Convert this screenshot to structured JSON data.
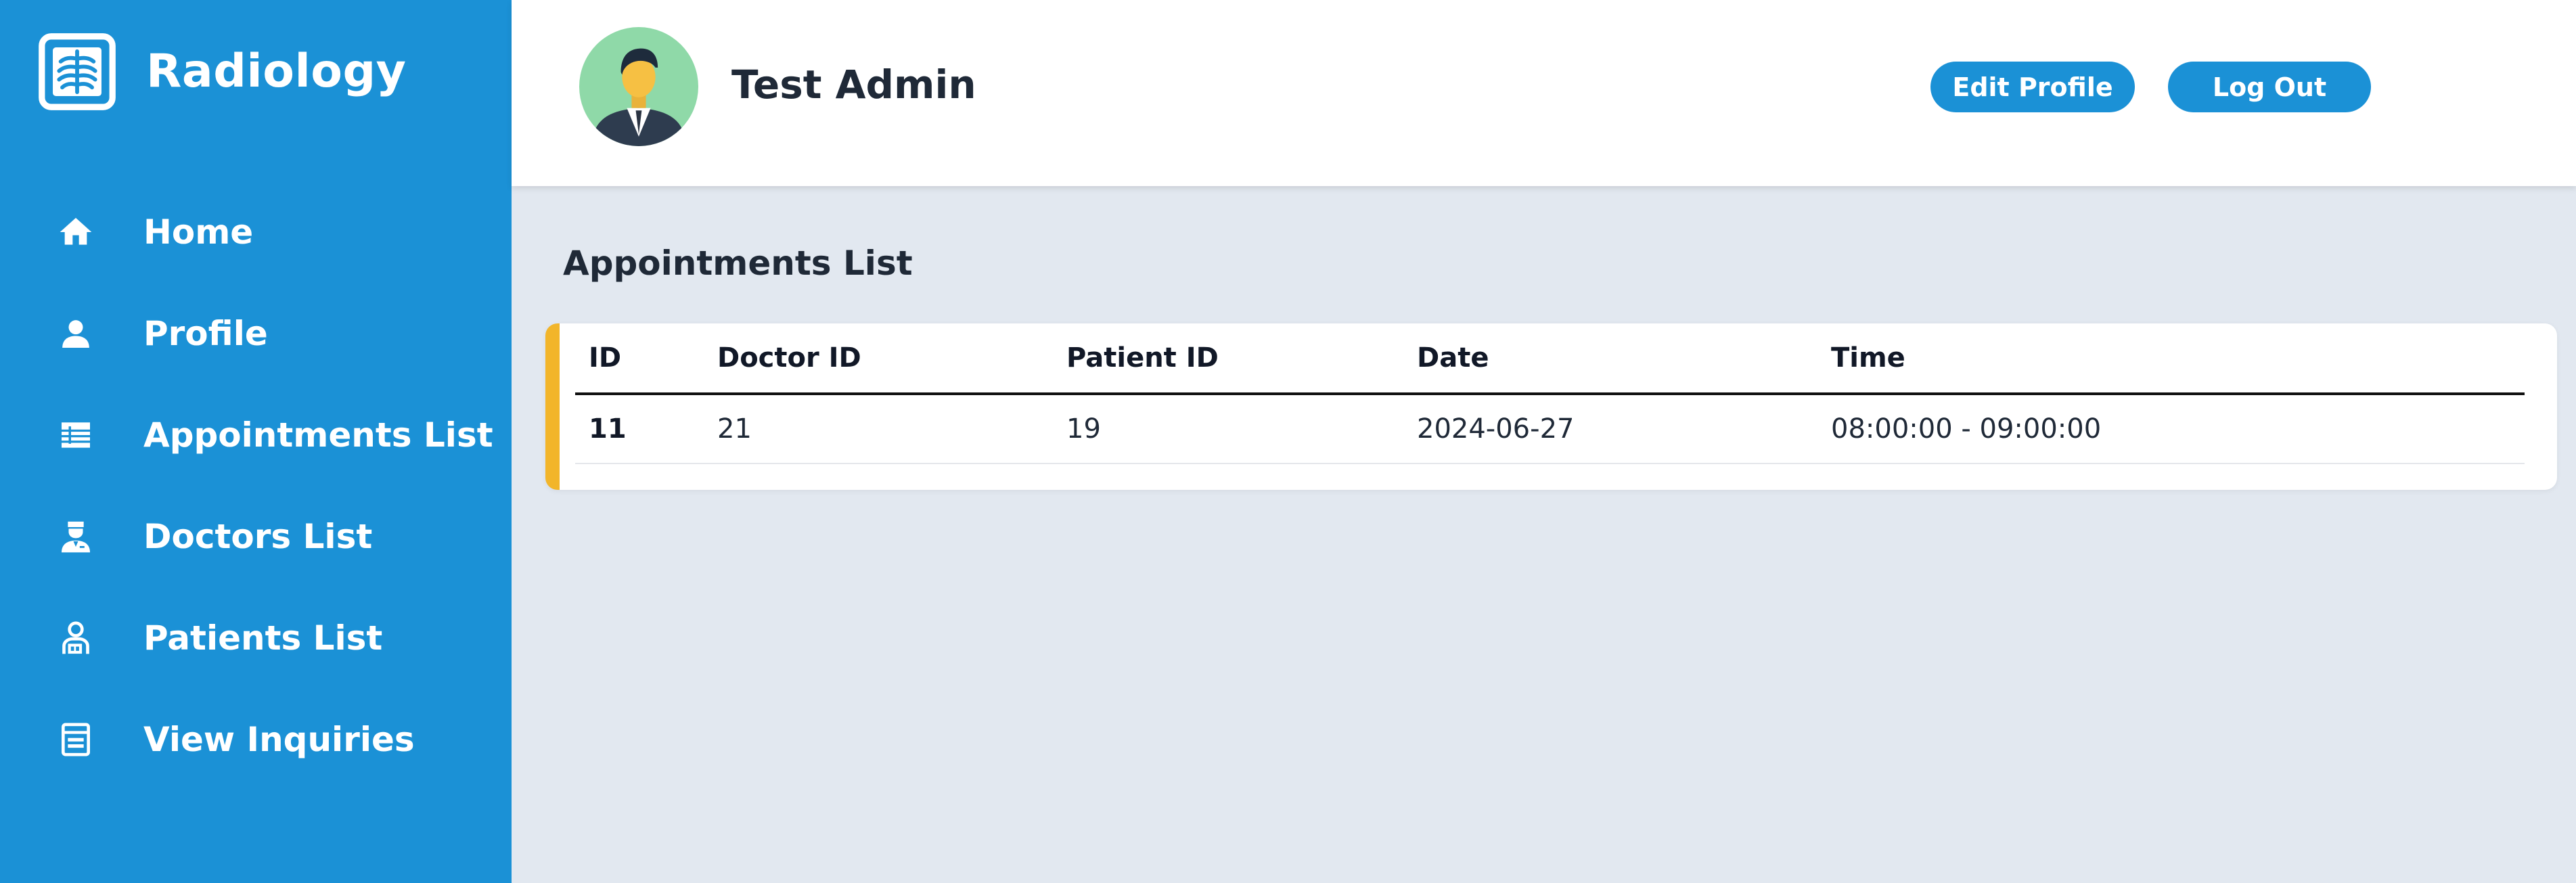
{
  "brand": {
    "name": "Radiology",
    "logo_icon": "xray-chest-icon"
  },
  "sidebar": {
    "items": [
      {
        "label": "Home",
        "icon": "home-icon"
      },
      {
        "label": "Profile",
        "icon": "user-icon"
      },
      {
        "label": "Appointments List",
        "icon": "list-icon"
      },
      {
        "label": "Doctors List",
        "icon": "doctor-icon"
      },
      {
        "label": "Patients List",
        "icon": "patient-icon"
      },
      {
        "label": "View Inquiries",
        "icon": "inquiry-icon"
      }
    ]
  },
  "header": {
    "user_name": "Test Admin",
    "avatar_icon": "avatar-businessman",
    "edit_profile_label": "Edit Profile",
    "logout_label": "Log Out"
  },
  "main": {
    "title": "Appointments List",
    "table": {
      "columns": [
        "ID",
        "Doctor ID",
        "Patient ID",
        "Date",
        "Time"
      ],
      "rows": [
        [
          "11",
          "21",
          "19",
          "2024-06-27",
          "08:00:00 - 09:00:00"
        ]
      ]
    }
  },
  "colors": {
    "primary": "#1b91d6",
    "accent": "#f2b52a",
    "background": "#e2e8f0",
    "avatar_bg": "#8fd9a8"
  }
}
